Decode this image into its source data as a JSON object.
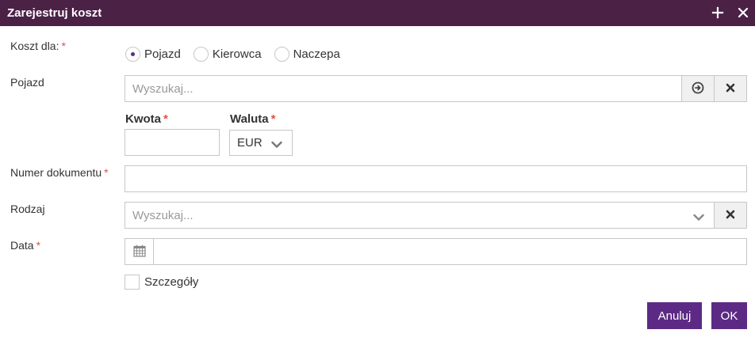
{
  "dialog": {
    "title": "Zarejestruj koszt",
    "maximize_icon": "plus-icon",
    "close_icon": "close-icon"
  },
  "form": {
    "cost_for": {
      "label": "Koszt dla:",
      "required_mark": "*",
      "options": [
        "Pojazd",
        "Kierowca",
        "Naczepa"
      ],
      "selected": "Pojazd"
    },
    "vehicle": {
      "label": "Pojazd",
      "placeholder": "Wyszukaj...",
      "go_icon": "arrow-circle-right-icon",
      "clear_icon": "close-icon"
    },
    "amount": {
      "label": "Kwota",
      "required_mark": "*",
      "value": ""
    },
    "currency": {
      "label": "Waluta",
      "required_mark": "*",
      "value": "EUR"
    },
    "document_number": {
      "label": "Numer dokumentu",
      "required_mark": "*",
      "value": ""
    },
    "type": {
      "label": "Rodzaj",
      "placeholder": "Wyszukaj...",
      "clear_icon": "close-icon"
    },
    "date": {
      "label": "Data",
      "required_mark": "*",
      "icon": "calendar-icon",
      "value": ""
    },
    "details": {
      "label": "Szczegóły",
      "checked": false
    }
  },
  "actions": {
    "cancel_label": "Anuluj",
    "ok_label": "OK"
  },
  "colors": {
    "titlebar": "#4b2146",
    "accent": "#5c2a84",
    "required": "#d9534f",
    "border": "#c7c7c7"
  }
}
